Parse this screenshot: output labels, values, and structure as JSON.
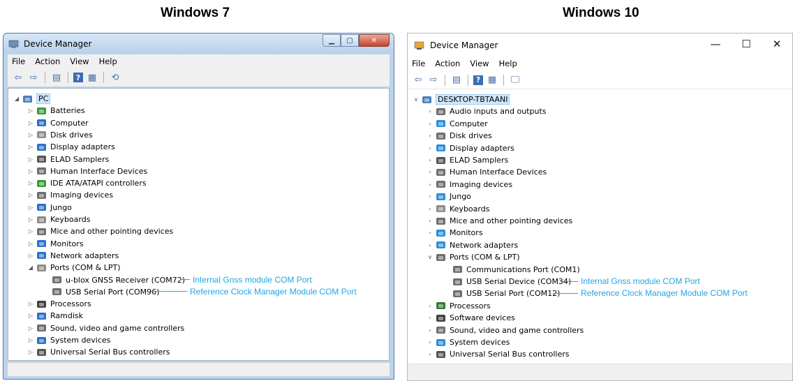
{
  "headings": {
    "left": "Windows 7",
    "right": "Windows 10"
  },
  "win7": {
    "title": "Device Manager",
    "menu": [
      "File",
      "Action",
      "View",
      "Help"
    ],
    "toolbar_icons": [
      "back-arrow-icon",
      "forward-arrow-icon",
      "properties-icon",
      "help-icon",
      "update-driver-icon",
      "scan-hardware-icon"
    ],
    "root": "PC",
    "items": [
      {
        "label": "Batteries",
        "icon": "battery-icon",
        "color": "#3a9a3a"
      },
      {
        "label": "Computer",
        "icon": "computer-icon",
        "color": "#2a6fc9"
      },
      {
        "label": "Disk drives",
        "icon": "disk-drive-icon",
        "color": "#8c8c8c"
      },
      {
        "label": "Display adapters",
        "icon": "display-adapter-icon",
        "color": "#2a6fc9"
      },
      {
        "label": "ELAD Samplers",
        "icon": "usb-device-icon",
        "color": "#555555"
      },
      {
        "label": "Human Interface Devices",
        "icon": "hid-icon",
        "color": "#6e6e6e"
      },
      {
        "label": "IDE ATA/ATAPI controllers",
        "icon": "ide-controller-icon",
        "color": "#3a9a3a"
      },
      {
        "label": "Imaging devices",
        "icon": "camera-icon",
        "color": "#6e6e6e"
      },
      {
        "label": "Jungo",
        "icon": "network-device-icon",
        "color": "#2a6fc9"
      },
      {
        "label": "Keyboards",
        "icon": "keyboard-icon",
        "color": "#8c8c8c"
      },
      {
        "label": "Mice and other pointing devices",
        "icon": "mouse-icon",
        "color": "#6e6e6e"
      },
      {
        "label": "Monitors",
        "icon": "monitor-icon",
        "color": "#2a6fc9"
      },
      {
        "label": "Network adapters",
        "icon": "network-adapter-icon",
        "color": "#2a6fc9"
      },
      {
        "label": "Ports (COM & LPT)",
        "icon": "port-icon",
        "color": "#8c8c8c",
        "expanded": true,
        "children": [
          {
            "label": "u-blox GNSS Receiver (COM72)",
            "icon": "port-icon"
          },
          {
            "label": "USB Serial Port (COM96)",
            "icon": "port-icon"
          }
        ]
      },
      {
        "label": "Processors",
        "icon": "processor-icon",
        "color": "#3f3f3f"
      },
      {
        "label": "Ramdisk",
        "icon": "ramdisk-icon",
        "color": "#2a6fc9"
      },
      {
        "label": "Sound, video and game controllers",
        "icon": "speaker-icon",
        "color": "#6e6e6e"
      },
      {
        "label": "System devices",
        "icon": "system-device-icon",
        "color": "#2a6fc9"
      },
      {
        "label": "Universal Serial Bus controllers",
        "icon": "usb-icon",
        "color": "#555555"
      }
    ],
    "annotations": [
      "Internal Gnss module COM Port",
      "Reference Clock Manager Module COM Port"
    ]
  },
  "win10": {
    "title": "Device Manager",
    "window_buttons": [
      "—",
      "☐",
      "✕"
    ],
    "menu": [
      "File",
      "Action",
      "View",
      "Help"
    ],
    "toolbar_icons": [
      "back-arrow-icon",
      "forward-arrow-icon",
      "properties-icon",
      "help-icon",
      "update-driver-icon",
      "monitor-scan-icon"
    ],
    "root": "DESKTOP-TBTAANI",
    "items": [
      {
        "label": "Audio inputs and outputs",
        "icon": "speaker-icon",
        "color": "#6e6e6e"
      },
      {
        "label": "Computer",
        "icon": "computer-icon",
        "color": "#2a8fd9"
      },
      {
        "label": "Disk drives",
        "icon": "disk-drive-icon",
        "color": "#6e6e6e"
      },
      {
        "label": "Display adapters",
        "icon": "display-adapter-icon",
        "color": "#2a8fd9"
      },
      {
        "label": "ELAD Samplers",
        "icon": "usb-device-icon",
        "color": "#555555"
      },
      {
        "label": "Human Interface Devices",
        "icon": "hid-icon",
        "color": "#6e6e6e"
      },
      {
        "label": "Imaging devices",
        "icon": "camera-icon",
        "color": "#6e6e6e"
      },
      {
        "label": "Jungo",
        "icon": "network-device-icon",
        "color": "#2a8fd9"
      },
      {
        "label": "Keyboards",
        "icon": "keyboard-icon",
        "color": "#8c8c8c"
      },
      {
        "label": "Mice and other pointing devices",
        "icon": "mouse-icon",
        "color": "#6e6e6e"
      },
      {
        "label": "Monitors",
        "icon": "monitor-icon",
        "color": "#2a8fd9"
      },
      {
        "label": "Network adapters",
        "icon": "network-adapter-icon",
        "color": "#2a8fd9"
      },
      {
        "label": "Ports (COM & LPT)",
        "icon": "port-icon",
        "color": "#6e6e6e",
        "expanded": true,
        "children": [
          {
            "label": "Communications Port (COM1)",
            "icon": "port-icon"
          },
          {
            "label": "USB Serial Device (COM34)",
            "icon": "port-icon"
          },
          {
            "label": "USB Serial Port (COM12)",
            "icon": "port-icon"
          }
        ]
      },
      {
        "label": "Processors",
        "icon": "processor-icon",
        "color": "#2e7d32"
      },
      {
        "label": "Software devices",
        "icon": "software-device-icon",
        "color": "#3f3f3f"
      },
      {
        "label": "Sound, video and game controllers",
        "icon": "speaker-icon",
        "color": "#6e6e6e"
      },
      {
        "label": "System devices",
        "icon": "system-device-icon",
        "color": "#2a8fd9"
      },
      {
        "label": "Universal Serial Bus controllers",
        "icon": "usb-icon",
        "color": "#555555"
      }
    ],
    "annotations": [
      "Internal Gnss module COM Port",
      "Reference Clock Manager Module COM Port"
    ]
  }
}
